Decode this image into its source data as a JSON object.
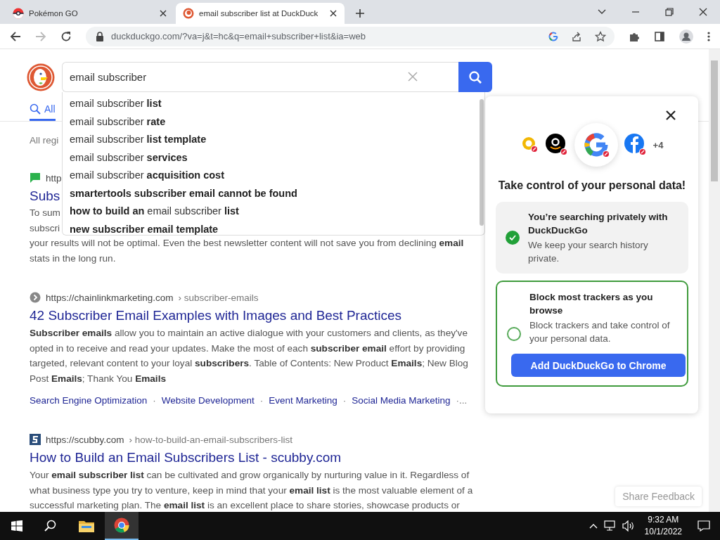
{
  "browser": {
    "tabs": [
      {
        "title": "Pokémon GO",
        "selected": false
      },
      {
        "title": "email subscriber list at DuckDuck",
        "selected": true
      }
    ],
    "address": "duckduckgo.com/?va=j&t=hc&q=email+subscriber+list&ia=web"
  },
  "search": {
    "value": "email subscriber",
    "suggestions": [
      {
        "text": "email subscriber **list**",
        "kind": "mixed"
      },
      {
        "text": "email subscriber **rate**",
        "kind": "mixed"
      },
      {
        "text": "email subscriber **list template**",
        "kind": "mixed"
      },
      {
        "text": "email subscriber **services**",
        "kind": "mixed"
      },
      {
        "text": "email subscriber **acquisition cost**",
        "kind": "mixed"
      },
      {
        "text": "smartertools subscriber email cannot be found",
        "kind": "bold"
      },
      {
        "text": "**how to build an** email subscriber **list**",
        "kind": "mixed"
      },
      {
        "text": "new subscriber email template",
        "kind": "bold"
      }
    ]
  },
  "search_tabs": [
    {
      "label": "All",
      "selected": true
    }
  ],
  "region": "All regi",
  "results": [
    {
      "url": "http",
      "title": "Subs",
      "snippet_lines": [
        "To sum",
        "subscri",
        "your results will not be optimal. Even the best newsletter content will not save you from declining **email**",
        "stats in the long run."
      ]
    },
    {
      "url": "https://chainlinkmarketing.com",
      "path": "› subscriber-emails",
      "title": "42 Subscriber Email Examples with Images and Best Practices",
      "snippet": "**Subscriber emails** allow you to maintain an active dialogue with your customers and clients, as they've opted in to receive and read your updates. Make the most of each **subscriber email** effort by providing targeted, relevant content to your loyal **subscribers**. Table of Contents: New Product **Emails**; New Blog Post **Emails**; Thank You **Emails**",
      "sitelinks": [
        {
          "text": "Search Engine Optimization",
          "kind": "link"
        },
        {
          "text": "·",
          "kind": "separator"
        },
        {
          "text": "Website Development",
          "kind": "link"
        },
        {
          "text": "·",
          "kind": "separator"
        },
        {
          "text": "Event Marketing",
          "kind": "link"
        },
        {
          "text": "·",
          "kind": "separator"
        },
        {
          "text": "Social Media Marketing",
          "kind": "link"
        },
        {
          "text": "·...",
          "kind": "separator"
        }
      ]
    },
    {
      "url": "https://scubby.com",
      "path": "› how-to-build-an-email-subscribers-list",
      "title": "How to Build an Email Subscribers List - scubby.com",
      "snippet": "Your **email subscriber list** can be cultivated and grow organically by nurturing value in it. Regardless of what business type you try to venture, keep in mind that your **email list** is the most valuable element of a successful marketing plan. The **email list** is an excellent place to share stories, showcase products or"
    }
  ],
  "panel": {
    "more_trackers": "+4",
    "heading": "Take control of your personal data!",
    "steps": [
      {
        "title": "You’re searching privately with DuckDuckGo",
        "text": "We keep your search history private.",
        "checked": true
      },
      {
        "title": "Block most trackers as you browse",
        "text": "Block trackers and take control of your personal data.",
        "checked": false,
        "button": "Add DuckDuckGo to Chrome"
      }
    ]
  },
  "feedback_button": "Share Feedback",
  "taskbar": {
    "time": "9:32 AM",
    "date": "10/1/2022"
  }
}
